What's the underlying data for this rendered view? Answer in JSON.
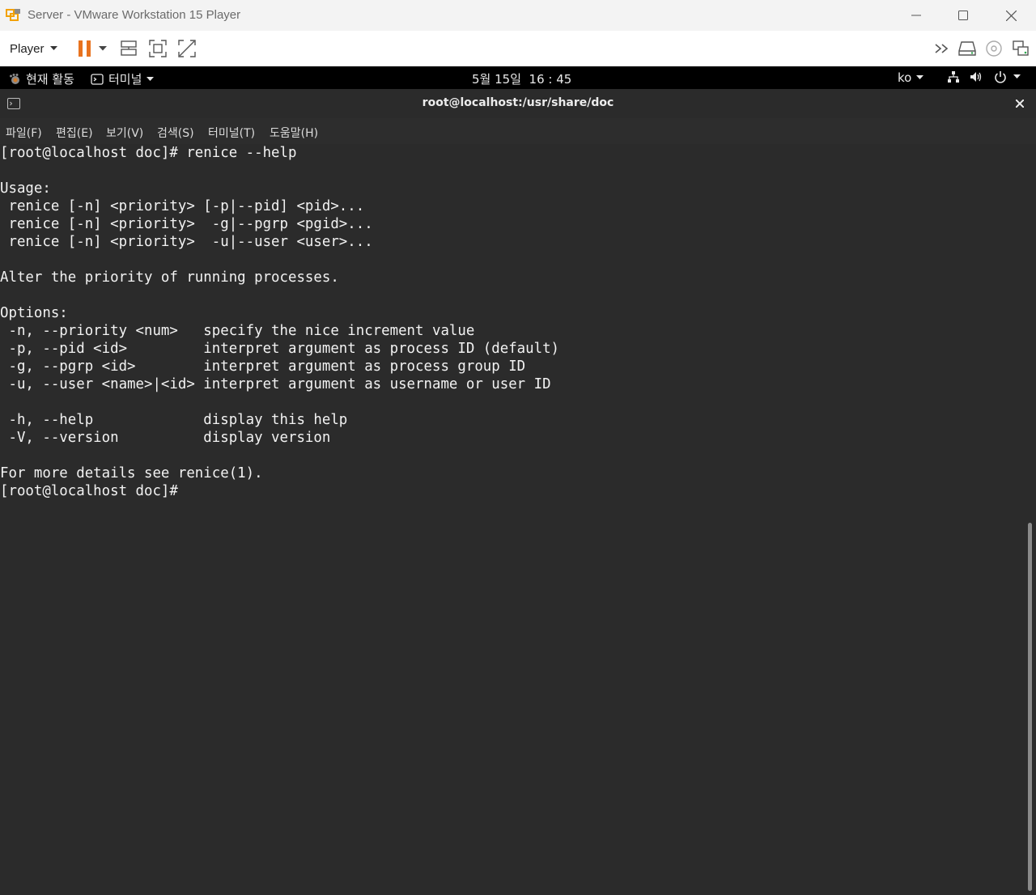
{
  "window": {
    "title": "Server - VMware Workstation 15 Player"
  },
  "toolbar": {
    "player_label": "Player"
  },
  "gnome": {
    "activities": "현재 활동",
    "app_menu": "터미널",
    "clock": "5월 15일  16 : 45",
    "input_method": "ko"
  },
  "terminal": {
    "title": "root@localhost:/usr/share/doc",
    "menu": [
      "파일(F)",
      "편집(E)",
      "보기(V)",
      "검색(S)",
      "터미널(T)",
      "도움말(H)"
    ],
    "lines": [
      "[root@localhost doc]# renice --help",
      "",
      "Usage:",
      " renice [-n] <priority> [-p|--pid] <pid>...",
      " renice [-n] <priority>  -g|--pgrp <pgid>...",
      " renice [-n] <priority>  -u|--user <user>...",
      "",
      "Alter the priority of running processes.",
      "",
      "Options:",
      " -n, --priority <num>   specify the nice increment value",
      " -p, --pid <id>         interpret argument as process ID (default)",
      " -g, --pgrp <id>        interpret argument as process group ID",
      " -u, --user <name>|<id> interpret argument as username or user ID",
      "",
      " -h, --help             display this help",
      " -V, --version          display version",
      "",
      "For more details see renice(1).",
      "[root@localhost doc]# "
    ]
  }
}
